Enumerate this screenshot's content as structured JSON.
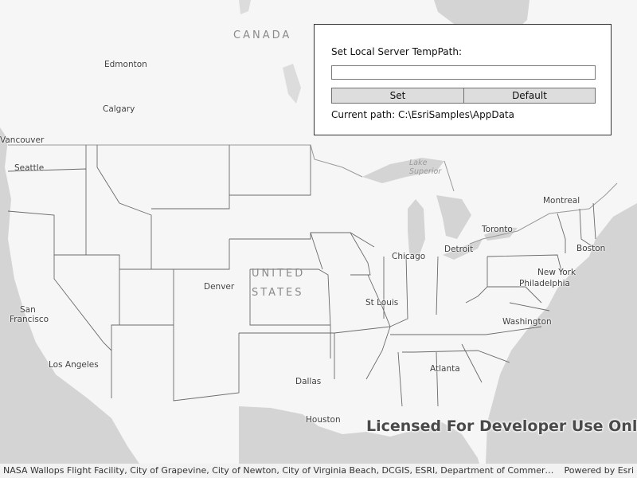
{
  "panel": {
    "prompt": "Set Local Server TempPath:",
    "path_input_value": "",
    "set_label": "Set",
    "default_label": "Default",
    "current_path": "Current path: C:\\EsriSamples\\AppData"
  },
  "map": {
    "country_labels": [
      "CANADA",
      "UNITED",
      "STATES"
    ],
    "water_labels": [
      "Lake",
      "Superior"
    ],
    "cities": {
      "edmonton": "Edmonton",
      "calgary": "Calgary",
      "vancouver": "Vancouver",
      "seattle": "Seattle",
      "san_francisco_1": "San",
      "san_francisco_2": "Francisco",
      "los_angeles": "Los Angeles",
      "denver": "Denver",
      "dallas": "Dallas",
      "houston": "Houston",
      "st_louis": "St Louis",
      "chicago": "Chicago",
      "detroit": "Detroit",
      "toronto": "Toronto",
      "montreal": "Montreal",
      "boston": "Boston",
      "new_york": "New York",
      "philadelphia": "Philadelphia",
      "washington": "Washington",
      "atlanta": "Atlanta"
    },
    "watermark": "Licensed For Developer Use Only",
    "colors": {
      "land": "#f7f7f7",
      "water": "#d3d3d3",
      "border": "#5a5a5a"
    }
  },
  "footer": {
    "attribution": "NASA Wallops Flight Facility, City of Grapevine, City of Newton, City of Virginia Beach, DCGIS, ESRI, Department of Commerce, Census Bureau, U.S. Department of Agriculture",
    "powered_by": "Powered by Esri"
  }
}
